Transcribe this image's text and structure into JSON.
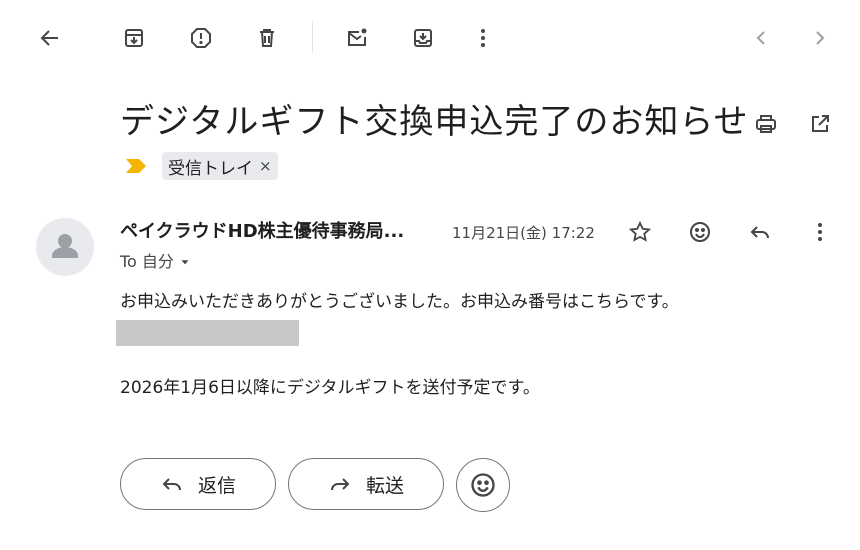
{
  "toolbar": {
    "back_icon": "arrow-left-icon",
    "archive_icon": "archive-icon",
    "report_icon": "report-spam-icon",
    "delete_icon": "trash-icon",
    "unread_icon": "mark-unread-icon",
    "move_icon": "move-to-icon",
    "more_icon": "more-vert-icon",
    "prev_icon": "chevron-left-icon",
    "next_icon": "chevron-right-icon"
  },
  "email": {
    "subject": "デジタルギフト交換申込完了のお知らせ",
    "label": "受信トレイ",
    "label_remove": "×",
    "sender": "ペイクラウドHD株主優待事務局...",
    "date": "11月21日(金) 17:22",
    "to": "To 自分",
    "body_line1": "お申込みいただきありがとうございました。お申込み番号はこちらです。",
    "body_line2": "2026年1月6日以降にデジタルギフトを送付予定です。"
  },
  "actions": {
    "reply_label": "返信",
    "forward_label": "転送"
  },
  "colors": {
    "label_marker": "#f4b400",
    "chip_bg": "#e8eaed",
    "redaction": "#c7c7c7",
    "icon": "#444746"
  }
}
